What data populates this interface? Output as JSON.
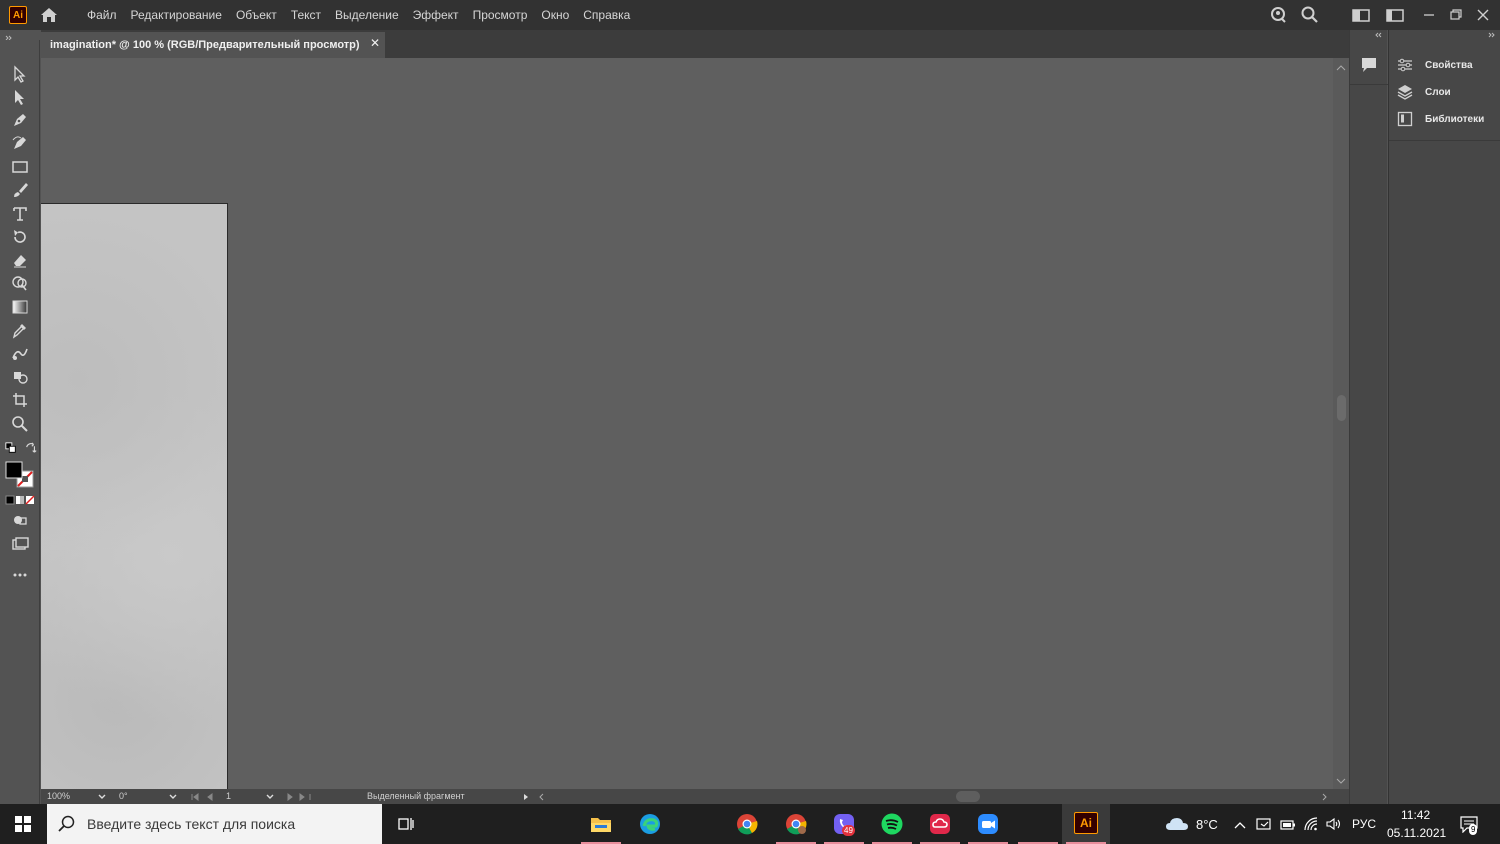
{
  "app": {
    "logo_text": "Ai",
    "menu": [
      "Файл",
      "Редактирование",
      "Объект",
      "Текст",
      "Выделение",
      "Эффект",
      "Просмотр",
      "Окно",
      "Справка"
    ]
  },
  "document": {
    "tab_title": "imagination* @ 100 % (RGB/Предварительный просмотр)",
    "close_glyph": "✕"
  },
  "status_bar": {
    "zoom": "100%",
    "rotation": "0°",
    "artboard_number": "1",
    "selection_label": "Выделенный фрагмент"
  },
  "panels": {
    "items": [
      {
        "label": "Свойства",
        "icon": "properties-icon"
      },
      {
        "label": "Слои",
        "icon": "layers-icon"
      },
      {
        "label": "Библиотеки",
        "icon": "libraries-icon"
      }
    ]
  },
  "taskbar": {
    "search_placeholder": "Введите здесь текст для поиска",
    "viber_badge": "49",
    "weather": "8°C",
    "language": "РУС",
    "time": "11:42",
    "date": "05.11.2021",
    "notifications_badge": "9"
  },
  "colors": {
    "menubar": "#323232",
    "canvas": "#5f5f5f",
    "panel": "#474747",
    "ai_accent": "#ff9a00",
    "taskbar": "#1f1f1f"
  }
}
